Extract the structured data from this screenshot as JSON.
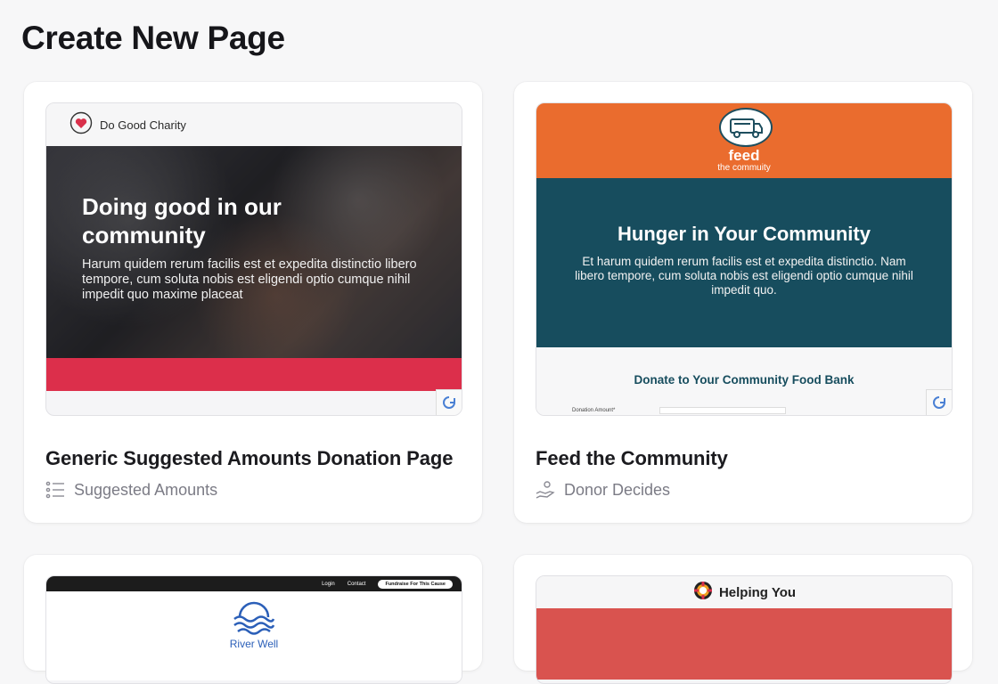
{
  "page": {
    "title": "Create New Page"
  },
  "cards": [
    {
      "title": "Generic Suggested Amounts Donation Page",
      "type_label": "Suggested Amounts",
      "type_icon": "list-icon",
      "preview": {
        "org_name": "Do Good Charity",
        "hero_title": "Doing good in our community",
        "hero_body": "Harum quidem rerum facilis est et expedita distinctio libero tempore, cum soluta nobis est eligendi optio cumque nihil impedit quo maxime placeat",
        "band_color": "#dc2f4b"
      }
    },
    {
      "title": "Feed the Community",
      "type_label": "Donor Decides",
      "type_icon": "hand-coin-icon",
      "preview": {
        "logo_title": "feed",
        "logo_subtitle": "the commuity",
        "hero_title": "Hunger in Your Community",
        "hero_body": "Et harum quidem rerum facilis est et expedita distinctio. Nam libero tempore, cum soluta nobis est eligendi optio cumque nihil impedit quo.",
        "form_title": "Donate to Your Community Food Bank",
        "form_label": "Donation Amount*",
        "header_color": "#ea6c2e",
        "hero_color": "#174d5e"
      }
    },
    {
      "preview": {
        "nav_links": [
          "Login",
          "Contact"
        ],
        "nav_button": "Fundraise For This Cause",
        "org_name": "River Well"
      }
    },
    {
      "preview": {
        "org_name": "Helping You",
        "band_color": "#d9534f"
      }
    }
  ]
}
